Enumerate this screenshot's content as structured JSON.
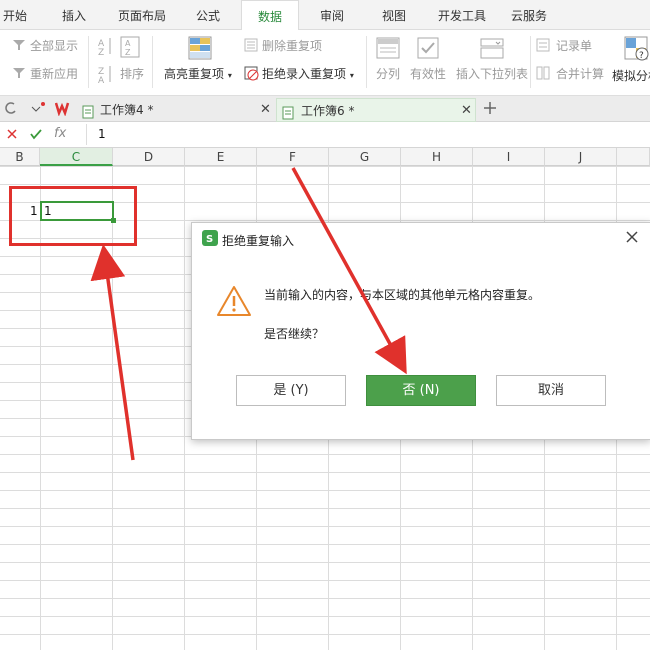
{
  "ribbon_tabs": [
    "开始",
    "插入",
    "页面布局",
    "公式",
    "数据",
    "审阅",
    "视图",
    "开发工具",
    "云服务"
  ],
  "active_tab": "数据",
  "ribbon": {
    "show_all": "全部显示",
    "reapply": "重新应用",
    "sort": "排序",
    "highlight_dup": "高亮重复项",
    "delete_dup": "删除重复项",
    "reject_dup": "拒绝录入重复项",
    "split": "分列",
    "validity": "有效性",
    "insert_dropdown": "插入下拉列表",
    "record": "记录单",
    "merge_calc": "合并计算",
    "simulate": "模拟分析"
  },
  "doc_tabs": [
    {
      "label": "工作簿4 *"
    },
    {
      "label": "工作簿6 *"
    }
  ],
  "formula_bar": {
    "fx": "fx",
    "value": "1"
  },
  "columns": [
    "B",
    "C",
    "D",
    "E",
    "F",
    "G",
    "H",
    "I",
    "J"
  ],
  "selected_column": "C",
  "cells": {
    "b_value": "1",
    "c_value": "1"
  },
  "dialog": {
    "title": "拒绝重复输入",
    "message": "当前输入的内容，与本区域的其他单元格内容重复。",
    "question": "是否继续？",
    "yes_label": "是 (Y)",
    "no_label": "否 (N)",
    "cancel_label": "取消"
  },
  "colors": {
    "accent_green": "#4ca04b",
    "annotation_red": "#e0312c",
    "warning_orange": "#e8872b"
  }
}
